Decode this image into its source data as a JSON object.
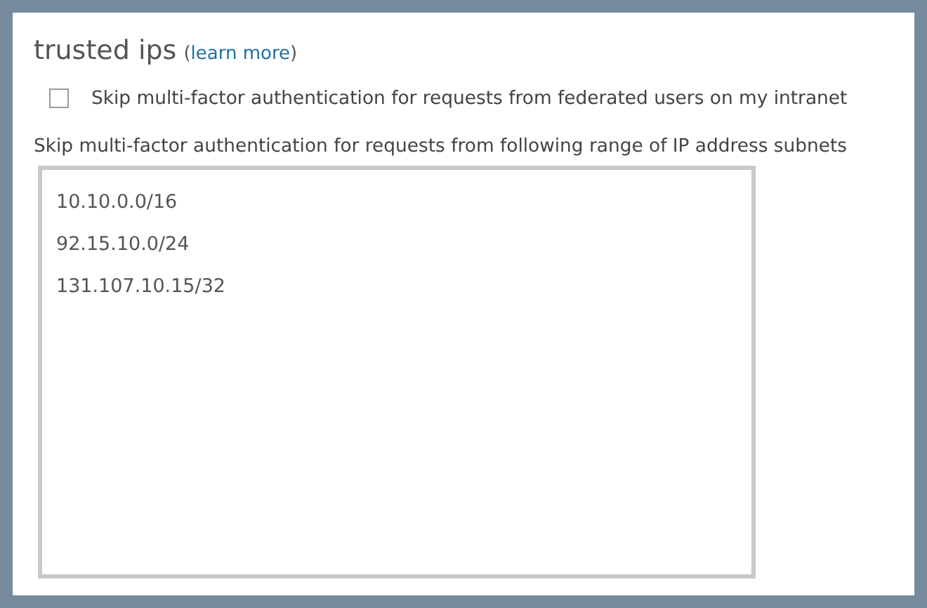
{
  "section": {
    "title": "trusted ips",
    "link_open": "(",
    "link": "learn more",
    "link_close": ")"
  },
  "federated_option": {
    "label": "Skip multi-factor authentication for requests from federated users on my intranet",
    "checked": false
  },
  "subnets": {
    "label": "Skip multi-factor authentication for requests from following range of IP address subnets",
    "values": [
      "10.10.0.0/16",
      "92.15.10.0/24",
      "131.107.10.15/32"
    ]
  }
}
